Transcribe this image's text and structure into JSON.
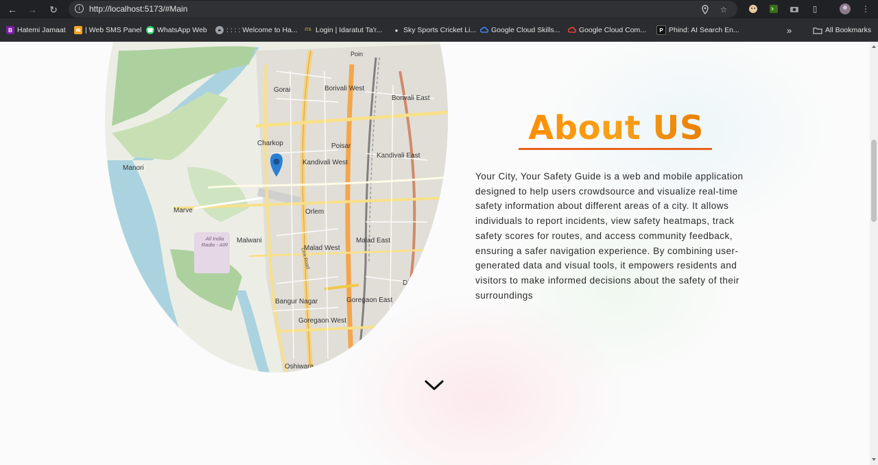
{
  "browser": {
    "url": "http://localhost:5173/#Main",
    "bookmarks": [
      {
        "label": "Hatemi Jamaat",
        "icon": "b-logo-icon",
        "color": "#6a1b9a",
        "glyph": "B"
      },
      {
        "label": "| Web SMS Panel",
        "icon": "sms-icon",
        "color": "#f4a21d",
        "glyph": "✉"
      },
      {
        "label": "WhatsApp Web",
        "icon": "whatsapp-icon",
        "color": "#25d366",
        "glyph": "✆"
      },
      {
        "label": ": : : : Welcome to Ha...",
        "icon": "globe-icon",
        "color": "#9aa0a6",
        "glyph": "◍"
      },
      {
        "label": "Login | Idaratut Ta'r...",
        "icon": "its-icon",
        "color": "#6b5b2e",
        "glyph": "ITS"
      },
      {
        "label": "Sky Sports Cricket Li...",
        "icon": "cricket-icon",
        "color": "#e0e0e0",
        "glyph": "●"
      },
      {
        "label": "Google Cloud Skills...",
        "icon": "google-cloud-icon",
        "color": "#4285f4",
        "glyph": "☁"
      },
      {
        "label": "Google Cloud Com...",
        "icon": "google-cloud-icon",
        "color": "#4285f4",
        "glyph": "☁"
      },
      {
        "label": "Phind: AI Search En...",
        "icon": "phind-icon",
        "color": "#111111",
        "glyph": "P"
      }
    ],
    "all_bookmarks": "All Bookmarks",
    "overflow": "»"
  },
  "map": {
    "labels": [
      {
        "text": "Gorai"
      },
      {
        "text": "Borivali West"
      },
      {
        "text": "Borivali East"
      },
      {
        "text": "Charkop"
      },
      {
        "text": "Poisar"
      },
      {
        "text": "Kandivali West"
      },
      {
        "text": "Kandivali East"
      },
      {
        "text": "Manori"
      },
      {
        "text": "Marve"
      },
      {
        "text": "Orlem"
      },
      {
        "text": "Malwani"
      },
      {
        "text": "Malad West"
      },
      {
        "text": "Malad East"
      },
      {
        "text": "Dindoshi"
      },
      {
        "text": "Bangur Nagar"
      },
      {
        "text": "Goregaon East"
      },
      {
        "text": "Goregaon West"
      },
      {
        "text": "Oshiwara"
      },
      {
        "text": "All India Radio - AIR"
      },
      {
        "text": "Link Road"
      },
      {
        "text": "Poin"
      }
    ]
  },
  "about": {
    "title": "About US",
    "description": "Your City, Your Safety Guide is a web and mobile application designed to help users crowdsource and visualize real-time safety information about different areas of a city. It allows individuals to report incidents, view safety heatmaps, track safety scores for routes, and access community feedback, ensuring a safer navigation experience. By combining user-generated data and visual tools, it empowers residents and visitors to make informed decisions about the safety of their surroundings"
  },
  "colors": {
    "title_gradient_start": "#ff8c00",
    "underline": "#e8621c",
    "pin": "#2a7fd4"
  }
}
